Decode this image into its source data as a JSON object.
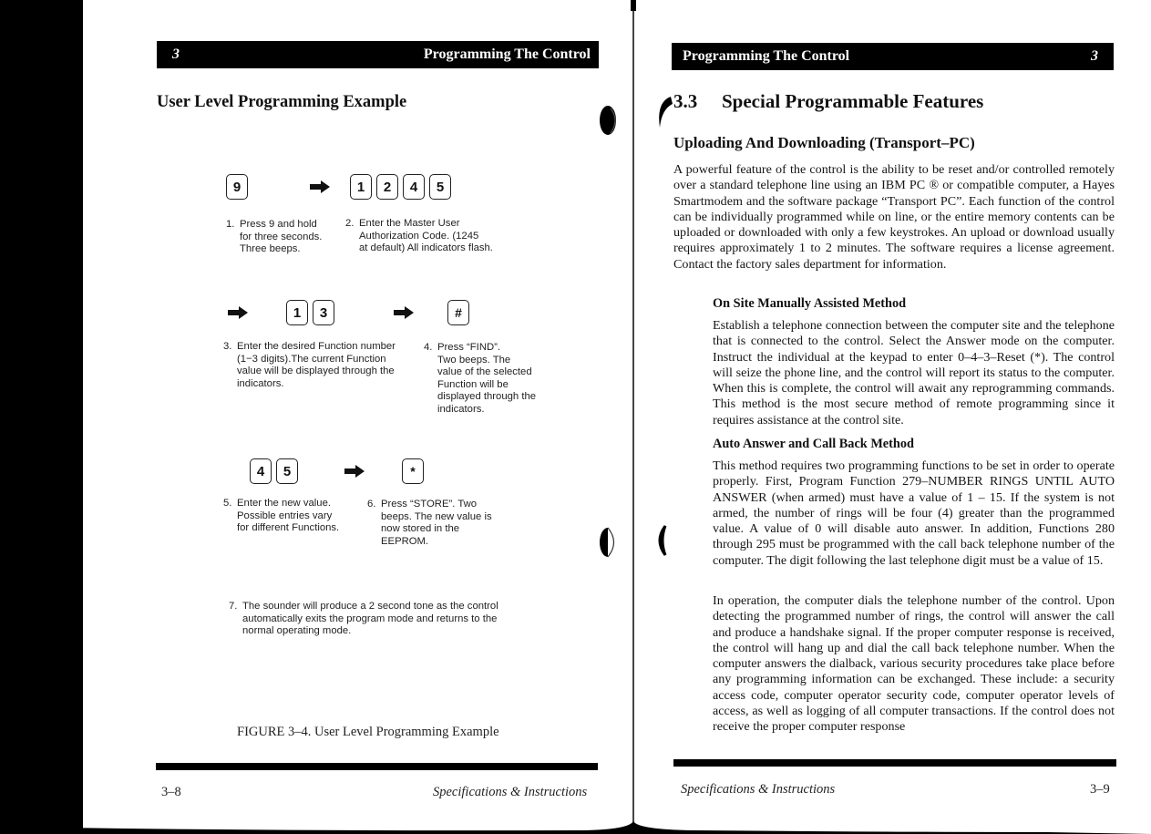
{
  "left_page": {
    "header": {
      "chapter": "3",
      "title": "Programming The Control"
    },
    "page_title": "User Level Programming Example",
    "figure": {
      "rows": [
        {
          "groups": [
            {
              "keys": [
                "9"
              ]
            },
            {
              "arrow": true
            },
            {
              "keys": [
                "1",
                "2",
                "4",
                "5"
              ]
            }
          ]
        },
        {
          "groups": [
            {
              "arrow": true
            },
            {
              "keys": [
                "1",
                "3"
              ]
            },
            {
              "arrow": true
            },
            {
              "keys": [
                "#"
              ]
            }
          ]
        },
        {
          "groups": [
            {
              "keys": [
                "4",
                "5"
              ]
            },
            {
              "arrow": true
            },
            {
              "keys": [
                "*"
              ]
            }
          ]
        }
      ],
      "steps": [
        {
          "num": "1.",
          "text": "Press 9 and hold\nfor three seconds.\nThree beeps."
        },
        {
          "num": "2.",
          "text": "Enter the Master User\nAuthorization Code. (1245\nat default) All indicators flash."
        },
        {
          "num": "3.",
          "text": "Enter the desired Function number\n(1−3 digits).The current Function\nvalue will be displayed through the\nindicators."
        },
        {
          "num": "4.",
          "text": "Press “FIND”.\nTwo beeps. The\nvalue of the selected\nFunction will be\ndisplayed through the\nindicators."
        },
        {
          "num": "5.",
          "text": "Enter the new value.\nPossible entries vary\nfor different Functions."
        },
        {
          "num": "6.",
          "text": "Press “STORE”.  Two\nbeeps. The new value is\nnow stored in the\nEEPROM."
        },
        {
          "num": "7.",
          "text": "The sounder will produce a 2 second tone as the control\nautomatically exits the program mode and returns to the\nnormal operating mode."
        }
      ],
      "caption": "FIGURE  3–4.  User Level Programming Example"
    },
    "footer": {
      "page_number": "3–8",
      "doc_title": "Specifications & Instructions"
    }
  },
  "right_page": {
    "header": {
      "chapter": "3",
      "title": "Programming The Control"
    },
    "section_number": "3.3",
    "section_title": "Special Programmable Features",
    "subsection_title": "Uploading And Downloading (Transport–PC)",
    "intro_paragraph": "A powerful feature of the control is the ability to be reset and/or controlled remotely over a standard telephone line using an IBM PC ® or compatible computer, a Hayes Smartmodem and the software package “Transport PC”. Each function of the control can be individually programmed while on line, or the entire memory contents can be uploaded or downloaded with only a few keystrokes. An upload or download usually requires approximately 1 to 2 minutes. The software requires a license agreement. Contact the factory sales department for information.",
    "methods": [
      {
        "title": "On Site Manually Assisted Method",
        "paragraphs": [
          "Establish a telephone connection between the computer site and the telephone that is connected to the control. Select the Answer mode on the computer. Instruct the individual at the keypad to enter 0–4–3–Reset (*). The control will seize the phone line, and the control will report its status to the computer. When this is complete, the control will await any reprogramming commands. This method is the most secure method of remote programming since it requires assistance at the control site."
        ]
      },
      {
        "title": "Auto Answer and Call Back Method",
        "paragraphs": [
          "This method requires two programming functions to be set in order to operate properly.  First, Program Function 279–NUMBER RINGS UNTIL AUTO ANSWER (when armed) must have a value of 1 – 15.  If the system is not armed, the number of rings will be four (4) greater than the programmed value. A value of 0 will disable auto answer.  In addition, Functions 280 through 295 must be programmed with the call back telephone number of the computer. The digit following the last telephone digit must be a value of 15.",
          "In operation, the computer dials the telephone number of the control. Upon detecting the programmed number of rings, the control will answer the call and produce a handshake signal. If the proper computer response is received, the control will hang up and dial the call back telephone number. When the computer answers the dialback, various security procedures take place before any programming information can be exchanged. These include: a security access code, computer operator security code, computer operator levels of access, as well as logging of all computer transactions. If the control does not receive the proper computer response"
        ]
      }
    ],
    "footer": {
      "doc_title": "Specifications & Instructions",
      "page_number": "3–9"
    }
  }
}
